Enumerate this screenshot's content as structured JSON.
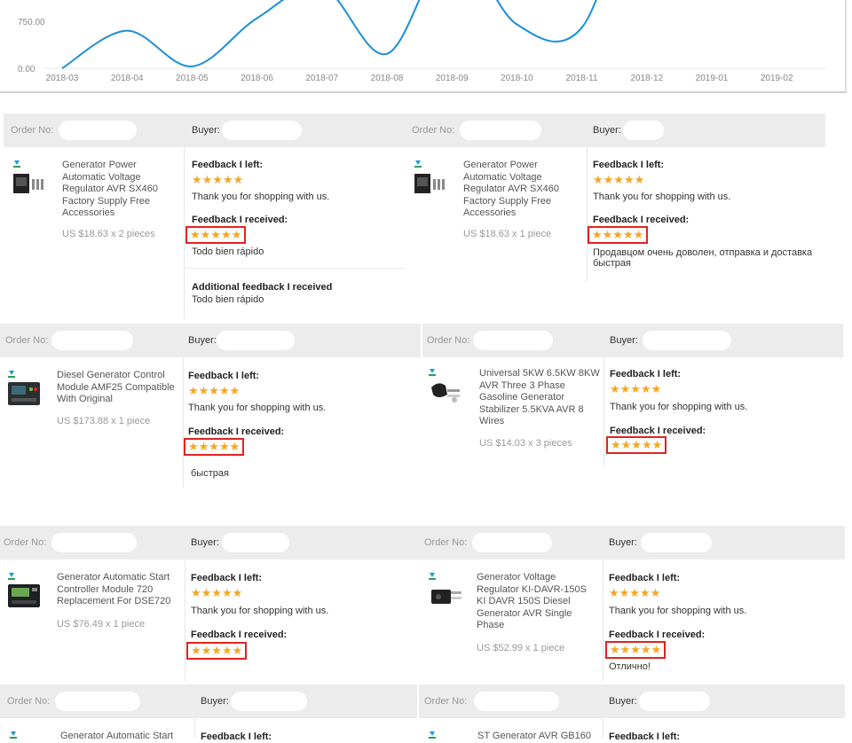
{
  "chart_data": {
    "type": "line",
    "x": [
      "2018-03",
      "2018-04",
      "2018-05",
      "2018-06",
      "2018-07",
      "2018-08",
      "2018-09",
      "2018-10",
      "2018-11",
      "2018-12",
      "2019-01",
      "2019-02"
    ],
    "series": [
      {
        "values": [
          0,
          600,
          30,
          800,
          1300,
          230,
          1950,
          700,
          650,
          3200,
          3000,
          1950
        ]
      }
    ],
    "ytick_labels": [
      "750.00",
      "0.00"
    ],
    "line_color": "#1a8fd8",
    "grid": false
  },
  "labels": {
    "order_no": "Order No:",
    "buyer": "Buyer:",
    "feedback_left": "Feedback I left:",
    "feedback_received": "Feedback I received:",
    "additional": "Additional feedback I received",
    "stars": "★★★★★"
  },
  "cards": [
    {
      "title": "Generator Power Automatic Voltage Regulator AVR SX460 Factory Supply Free Accessories",
      "price": "US $18.63 x 2 pieces",
      "left_text": "Thank you for shopping with us.",
      "received_text": "Todo bien rápido",
      "additional_text": "Todo bien rápido"
    },
    {
      "title": "Generator Power Automatic Voltage Regulator AVR SX460 Factory Supply Free Accessories",
      "price": "US $18.63 x 1 piece",
      "left_text": "Thank you for shopping with us.",
      "received_text": "Продавцом очень доволен, отправка и доставка быстрая"
    },
    {
      "title": "Diesel Generator Control Module AMF25 Compatible With Original",
      "price": "US $173.88 x 1 piece",
      "left_text": "Thank you for shopping with us.",
      "received_text": "быстрая"
    },
    {
      "title": "Universal 5KW 6.5KW 8KW AVR Three 3 Phase Gasoline Generator Stabilizer 5.5KVA AVR 8 Wires",
      "price": "US $14.03 x 3 pieces",
      "left_text": "Thank you for shopping with us.",
      "received_text": ""
    },
    {
      "title": "Generator Automatic Start Controller Module 720 Replacement For DSE720",
      "price": "US $76.49 x 1 piece",
      "left_text": "Thank you for shopping with us.",
      "received_text": ""
    },
    {
      "title": "Generator Voltage Regulator KI-DAVR-150S KI DAVR 150S Diesel Generator AVR Single Phase",
      "price": "US $52.99 x 1 piece",
      "left_text": "Thank you for shopping with us.",
      "received_text": "Отлично!"
    },
    {
      "title": "Generator Automatic Start",
      "price": "",
      "left_text": "",
      "received_text": ""
    },
    {
      "title": "ST Generator AVR GB160",
      "price": "",
      "left_text": "",
      "received_text": ""
    }
  ]
}
